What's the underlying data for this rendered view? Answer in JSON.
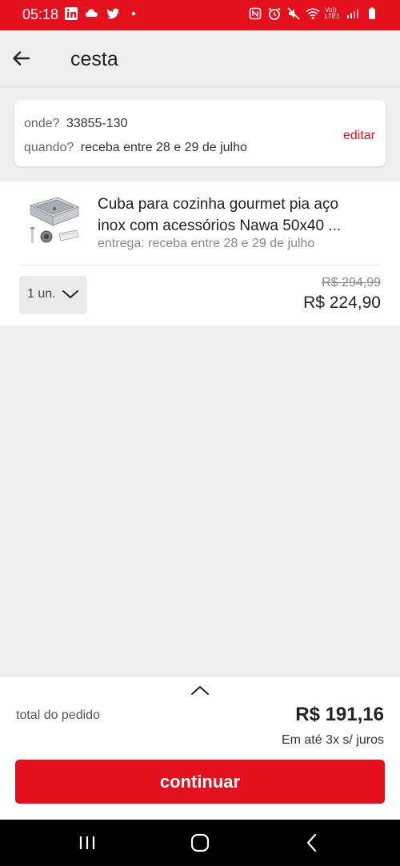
{
  "status_bar": {
    "time": "05:18",
    "left_icons": [
      "linkedin-icon",
      "cloud-icon",
      "twitter-icon",
      "dot-icon"
    ],
    "right_icons": [
      "nfc-icon",
      "alarm-icon",
      "mute-icon",
      "wifi-icon",
      "volte-icon",
      "signal-icon",
      "battery-icon"
    ],
    "volte_text": "Vo)) LTE1"
  },
  "header": {
    "title": "cesta"
  },
  "delivery": {
    "where_label": "onde?",
    "where_value": "33855-130",
    "when_label": "quando?",
    "when_value": "receba entre 28 e 29 de julho",
    "edit_label": "editar"
  },
  "product": {
    "title": "Cuba para cozinha gourmet pia aço inox com acessórios Nawa 50x40 ...",
    "delivery": "entrega: receba entre 28 e 29 de julho",
    "quantity": "1 un.",
    "old_price": "R$ 294,99",
    "price": "R$ 224,90"
  },
  "footer": {
    "total_label": "total do pedido",
    "total_value": "R$ 191,16",
    "installments": "Em até 3x s/ juros",
    "continue_label": "continuar"
  },
  "colors": {
    "brand_red": "#e3101e",
    "edit_red": "#d0111e",
    "background": "#efefef"
  }
}
